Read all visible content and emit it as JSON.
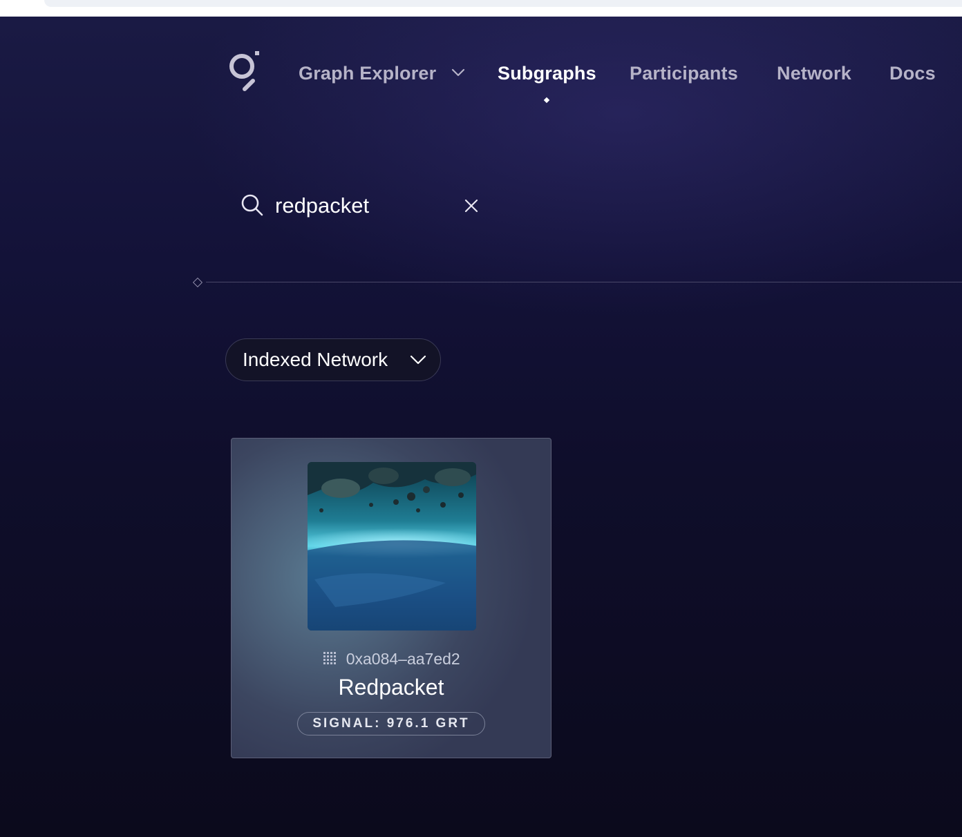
{
  "nav": {
    "explorer_label": "Graph Explorer",
    "items": [
      {
        "label": "Subgraphs",
        "active": true
      },
      {
        "label": "Participants",
        "active": false
      },
      {
        "label": "Network",
        "active": false
      },
      {
        "label": "Docs",
        "active": false
      }
    ]
  },
  "search": {
    "value": "redpacket"
  },
  "filter": {
    "label": "Indexed Network"
  },
  "results": [
    {
      "address": "0xa084–aa7ed2",
      "name": "Redpacket",
      "signal": "SIGNAL: 976.1 GRT"
    }
  ],
  "colors": {
    "accent_active": "#ffffff",
    "nav_inactive": "#b6b3c8",
    "background_top": "#1a1a44",
    "background_bottom": "#0b0a1c"
  },
  "icons": {
    "logo": "graph-logo-icon",
    "search": "search-icon",
    "clear": "close-icon",
    "chevron": "chevron-down-icon",
    "address": "grid-dots-icon"
  }
}
